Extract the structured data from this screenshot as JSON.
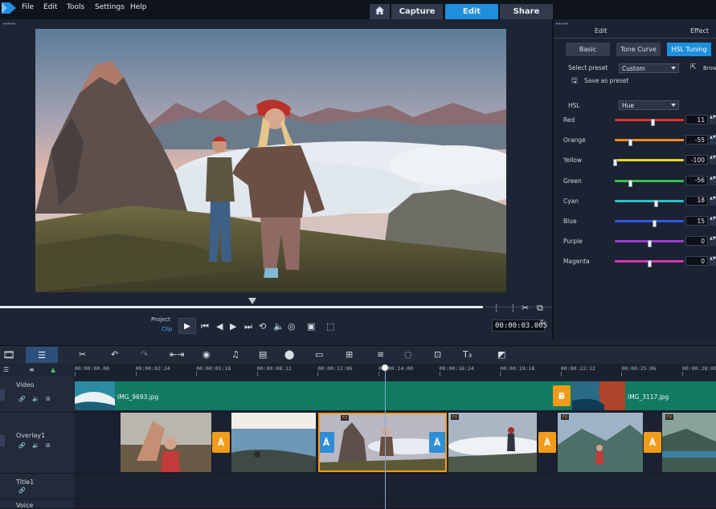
{
  "menubar": {
    "items": [
      "File",
      "Edit",
      "Tools",
      "Settings",
      "Help"
    ]
  },
  "modes": {
    "capture": "Capture",
    "edit": "Edit",
    "share": "Share"
  },
  "player": {
    "project_label": "Project",
    "clip_label": "Clip",
    "timecode": "00:00:03.005"
  },
  "panel": {
    "tab_edit": "Edit",
    "tab_effect": "Effect",
    "buttons": [
      "Basic",
      "Tone Curve",
      "HSL Tuning"
    ],
    "select_preset_label": "Select preset",
    "preset_value": "Custom",
    "browse_label": "Brow",
    "save_preset_label": "Save as preset",
    "hsl_label": "HSL",
    "hsl_mode": "Hue",
    "sliders": [
      {
        "name": "Red",
        "value": 11,
        "fill": 0.55,
        "color": "#e03030"
      },
      {
        "name": "Orange",
        "value": -55,
        "fill": 0.22,
        "color": "#ef8a20"
      },
      {
        "name": "Yellow",
        "value": -100,
        "fill": 0.0,
        "color": "#e5d61f"
      },
      {
        "name": "Green",
        "value": -56,
        "fill": 0.22,
        "color": "#34c24a"
      },
      {
        "name": "Cyan",
        "value": 18,
        "fill": 0.59,
        "color": "#1fc6c9"
      },
      {
        "name": "Blue",
        "value": 15,
        "fill": 0.57,
        "color": "#3357e6"
      },
      {
        "name": "Purple",
        "value": 0,
        "fill": 0.5,
        "color": "#9b39d6"
      },
      {
        "name": "Magenta",
        "value": 0,
        "fill": 0.5,
        "color": "#d336b0"
      }
    ]
  },
  "ruler": {
    "ticks": [
      "00:00:00.00",
      "00:00:02:24",
      "00:00:05:18",
      "00:00:08:12",
      "00:00:11:06",
      "00:00:14:00",
      "00:00:16:24",
      "00:00:19:18",
      "00:00:22:12",
      "00:00:25:06",
      "00:00:28:00"
    ]
  },
  "tracks": {
    "video": "Video",
    "overlay": "Overlay1",
    "title": "Title1",
    "voice": "Voice"
  },
  "clips": {
    "video_clip_1": "IMG_9693.jpg",
    "video_clip_2": "IMG_3117.jpg",
    "fx": "FX"
  }
}
